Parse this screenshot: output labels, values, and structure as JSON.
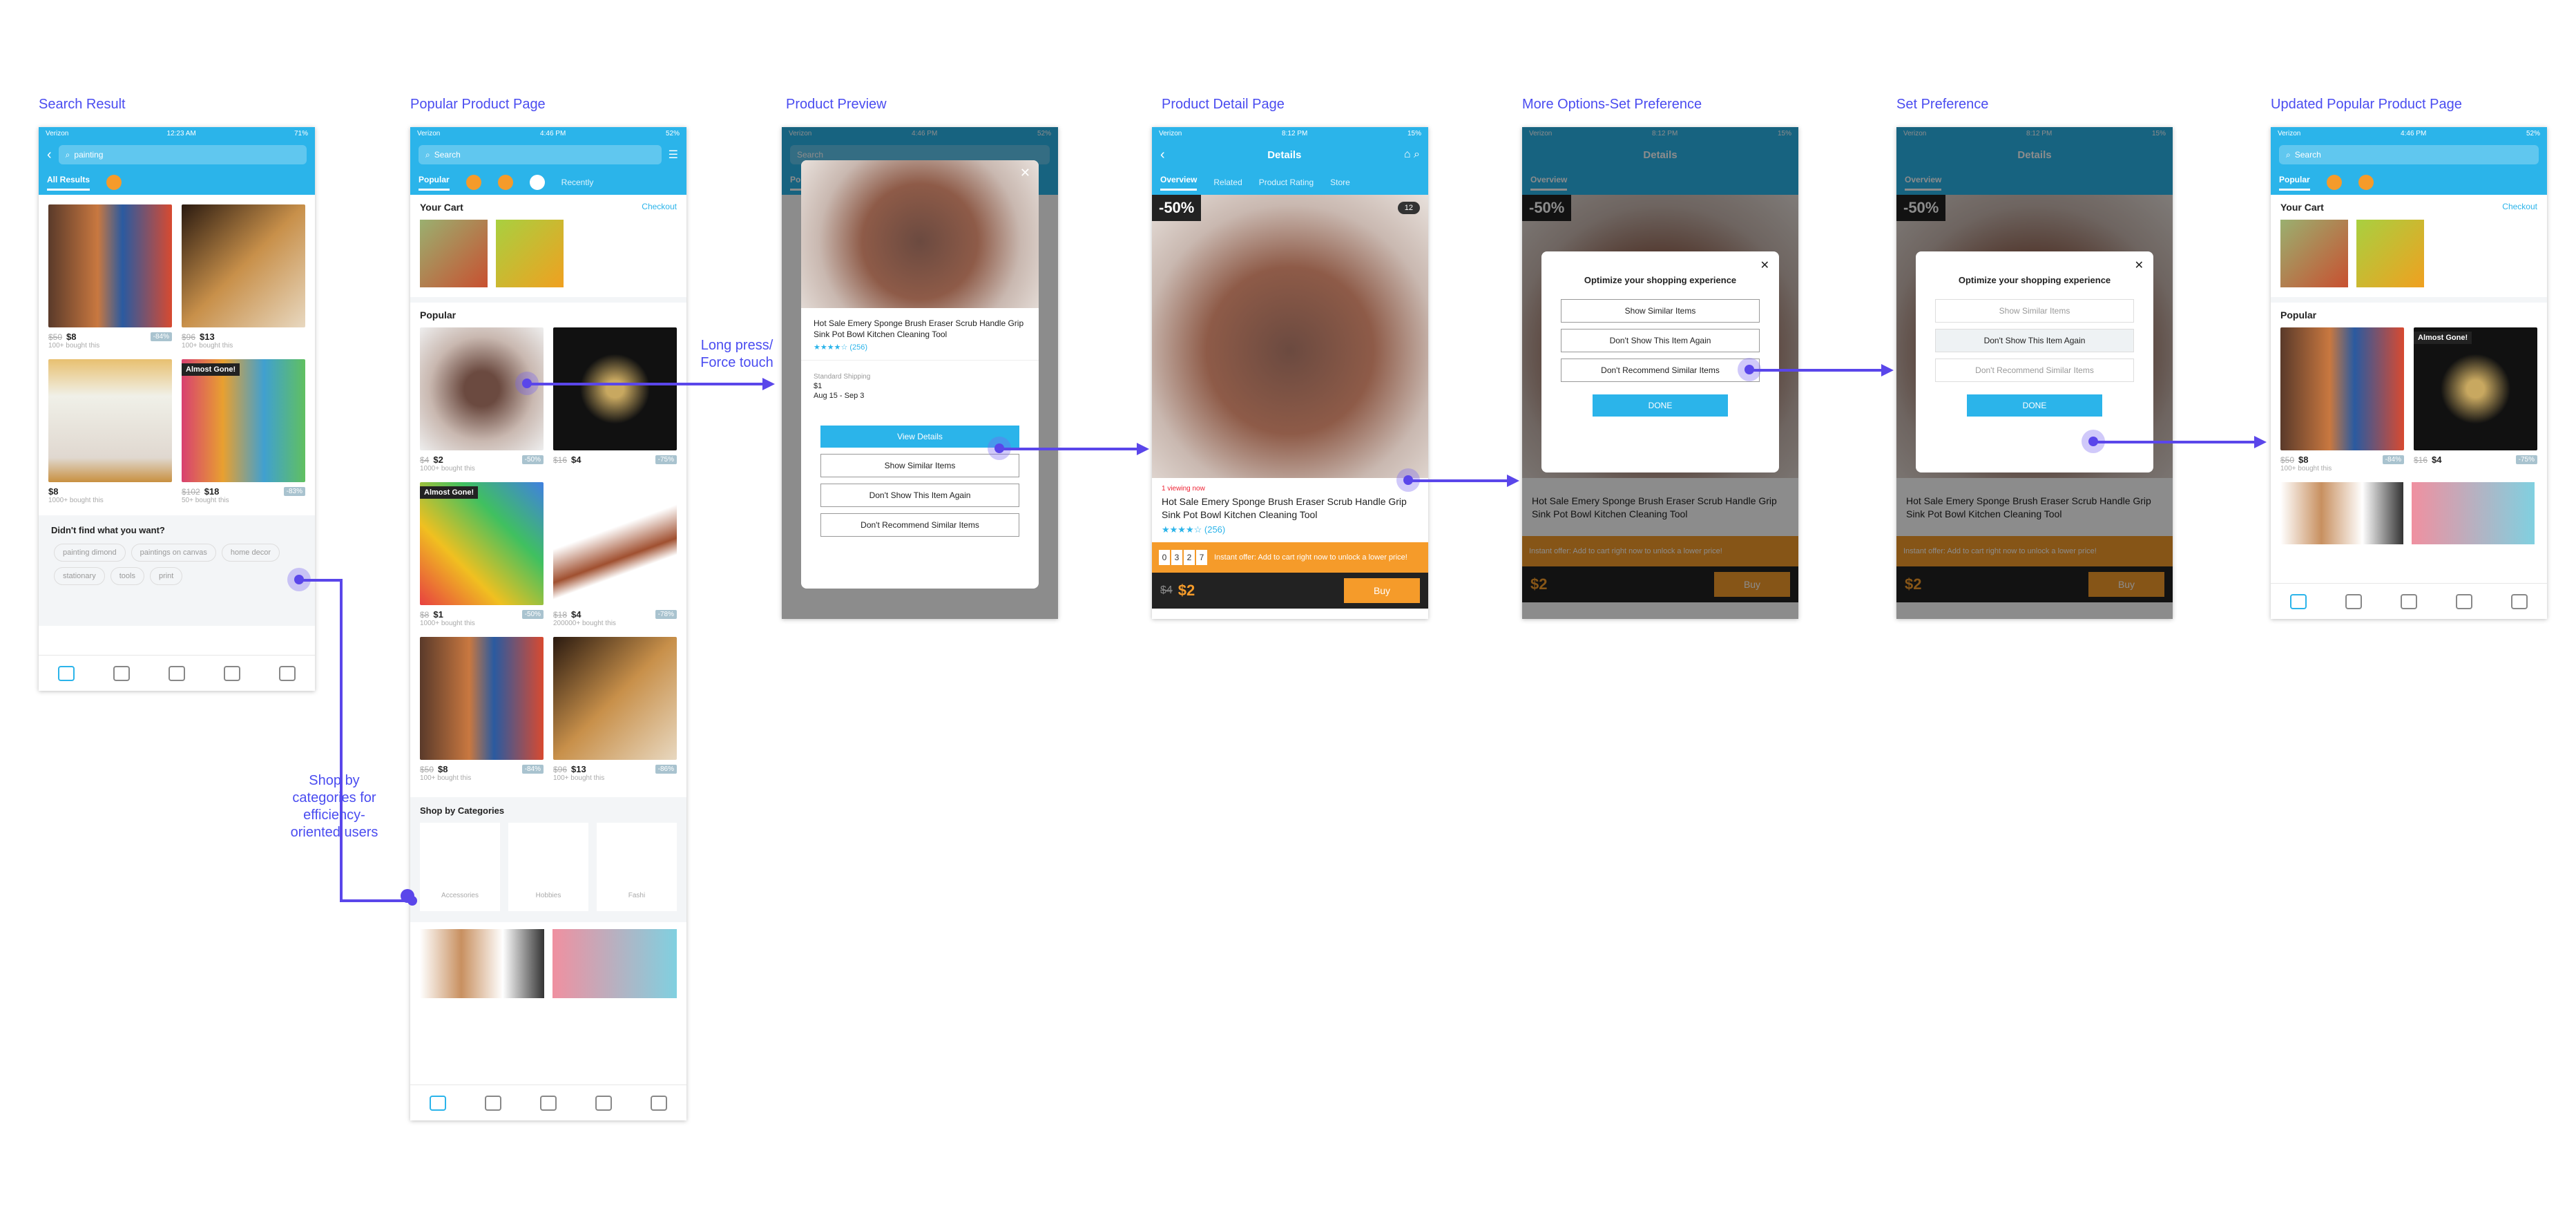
{
  "screens": {
    "search_result": "Search Result",
    "popular_product_page": "Popular Product Page",
    "product_preview": "Product Preview",
    "product_detail_page": "Product Detail Page",
    "more_options": "More Options-Set Preference",
    "set_preference": "Set Preference",
    "updated_popular": "Updated Popular Product Page"
  },
  "annotations": {
    "long_press": "Long press/\nForce touch",
    "shop_by": "Shop by\ncategories for\nefficiency-\noriented users"
  },
  "status": {
    "carrier": "Verizon",
    "time_search": "12:23 AM",
    "batt_search": "71%",
    "time_pop": "4:46 PM",
    "batt_pop": "52%",
    "time_det": "8:12 PM",
    "batt_det": "15%"
  },
  "search": {
    "query": "painting",
    "tab": "All Results",
    "items": [
      {
        "old": "$50",
        "price": "$8",
        "badge": "-84%",
        "sub": "100+ bought this"
      },
      {
        "old": "$96",
        "price": "$13",
        "badge": "",
        "sub": "100+ bought this"
      },
      {
        "old": "",
        "price": "$8",
        "badge": "",
        "sub": "1000+ bought this"
      },
      {
        "old": "$102",
        "price": "$18",
        "badge": "-83%",
        "sub": "50+ bought this",
        "flag": "Almost Gone!"
      }
    ],
    "didnt_find": "Didn't find what you want?",
    "tags": [
      "painting dimond",
      "paintings on canvas",
      "home decor",
      "stationary",
      "tools",
      "print"
    ]
  },
  "popular": {
    "placeholder": "Search",
    "tabs": [
      "Popular",
      "Recently"
    ],
    "your_cart": "Your Cart",
    "checkout": "Checkout",
    "popular_label": "Popular",
    "items": [
      {
        "old": "$4",
        "price": "$2",
        "badge": "-50%",
        "sub": "1000+ bought this"
      },
      {
        "old": "$16",
        "price": "$4",
        "badge": "-75%",
        "sub": ""
      },
      {
        "old": "$8",
        "price": "$1",
        "badge": "-50%",
        "sub": "1000+ bought this",
        "flag": "Almost Gone!"
      },
      {
        "old": "$18",
        "price": "$4",
        "badge": "-78%",
        "sub": "200000+ bought this"
      },
      {
        "old": "$50",
        "price": "$8",
        "badge": "-84%",
        "sub": "100+ bought this"
      },
      {
        "old": "$96",
        "price": "$13",
        "badge": "-86%",
        "sub": "100+ bought this"
      }
    ],
    "shop_by": "Shop by Categories",
    "categories": [
      "Accessories",
      "Hobbies",
      "Fashi"
    ]
  },
  "preview": {
    "title": "Hot Sale Emery Sponge Brush Eraser Scrub Handle Grip Sink Pot Bowl Kitchen Cleaning Tool",
    "reviews": "(256)",
    "ship_label": "Standard Shipping",
    "ship_price": "$1",
    "ship_dates": "Aug 15 - Sep 3",
    "view_details": "View Details",
    "show_similar": "Show Similar Items",
    "dont_show": "Don't Show This Item Again",
    "dont_recommend": "Don't Recommend Similar Items"
  },
  "detail": {
    "header": "Details",
    "tabs": [
      "Overview",
      "Related",
      "Product Rating",
      "Store"
    ],
    "discount": "-50%",
    "count": "12",
    "viewing": "1 viewing now",
    "title": "Hot Sale Emery Sponge Brush Eraser Scrub Handle Grip Sink Pot Bowl Kitchen Cleaning Tool",
    "reviews": "(256)",
    "digits": [
      "0",
      "3",
      "2",
      "7"
    ],
    "offer": "Instant offer: Add to cart right now to unlock a lower price!",
    "old": "$4",
    "price": "$2",
    "buy": "Buy"
  },
  "modal": {
    "title": "Optimize your shopping experience",
    "show_similar": "Show Similar Items",
    "dont_show": "Don't Show This Item Again",
    "dont_recommend": "Don't Recommend Similar Items",
    "done": "DONE"
  },
  "updated": {
    "items": [
      {
        "old": "$50",
        "price": "$8",
        "badge": "-84%",
        "sub": "100+ bought this"
      },
      {
        "old": "$16",
        "price": "$4",
        "badge": "-75%",
        "sub": "",
        "flag": "Almost Gone!"
      }
    ]
  }
}
